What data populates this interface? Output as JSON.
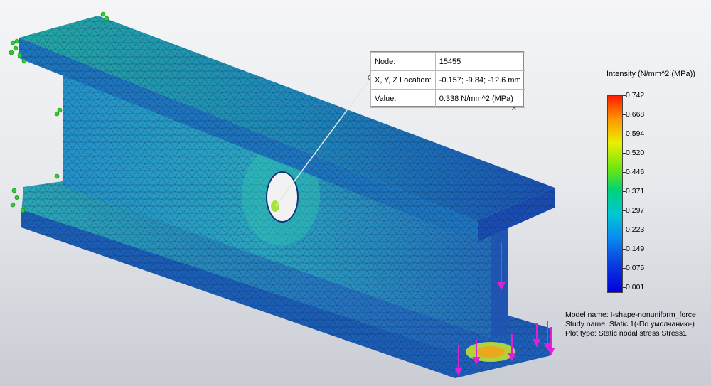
{
  "probe": {
    "node_label": "Node:",
    "node_value": "15455",
    "location_label": "X, Y, Z Location:",
    "location_value": "-0.157; -9.84; -12.6 mm",
    "value_label": "Value:",
    "value_value": "0.338 N/mm^2 (MPa)"
  },
  "collapse_glyph": "^",
  "legend": {
    "title": "Intensity (N/mm^2 (MPa))",
    "ticks": [
      "0.742",
      "0.668",
      "0.594",
      "0.520",
      "0.446",
      "0.371",
      "0.297",
      "0.223",
      "0.149",
      "0.075",
      "0.001"
    ]
  },
  "info": {
    "model_name": "Model name: I-shape-nonuniform_force",
    "study_name": "Study name: Static 1(-По умолчанию-)",
    "plot_type": "Plot type: Static nodal stress Stress1"
  },
  "colors": {
    "mesh_blue": "#2a6fbf",
    "mesh_teal": "#26a6b8",
    "top_flange": "#1f7fba",
    "fixture_green": "#2ecc2e",
    "load_magenta": "#e020d8"
  },
  "icons": [
    "fixture-arrow-icon",
    "load-arrow-icon",
    "collapse-chevron-icon"
  ]
}
